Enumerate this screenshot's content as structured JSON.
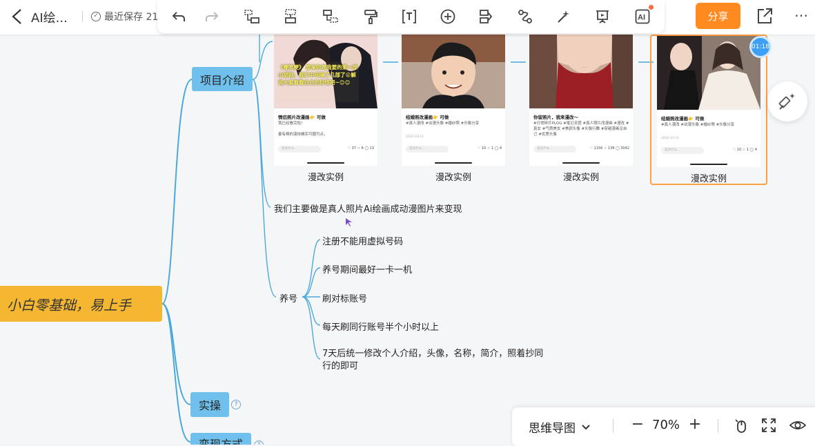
{
  "header": {
    "title": "AI绘...",
    "save_status": "最近保存 21",
    "share_label": "分享"
  },
  "toolbar": {
    "items": [
      "undo-icon",
      "redo-icon",
      "add-child-topic-icon",
      "add-sibling-topic-icon",
      "add-parent-topic-icon",
      "format-painter-icon",
      "text-icon",
      "insert-icon",
      "outline-icon",
      "relation-icon",
      "magic-icon",
      "present-icon",
      "ai-icon"
    ]
  },
  "timer": "01:18",
  "mindmap": {
    "root_text": "，小白零基础，易上手",
    "topics": {
      "intro": "项目介绍",
      "practice": "实操",
      "monetize": "变现方式"
    },
    "intro_text": "我们主要做是真人照片Ai绘画成动漫图片来变现",
    "raise_label": "养号",
    "raise_items": [
      "注册不能用虚拟号码",
      "养号期间最好一卡一机",
      "刷对标账号",
      "每天刷同行账号半个小时以上",
      "7天后统一修改个人介绍，头像，名称，简介，照着抄同行的即可"
    ],
    "cards": [
      {
        "label": "漫改实例",
        "title": "情侣照片改漫画👉 可做",
        "tags": "我已经看完啦！\n\n春有棉的演技确实可圈可点，",
        "date": "",
        "input": "说点什么...",
        "stats": "♡ 37  ☆ 6  ◯ 13",
        "overlay_text": "《嘲笑梗》 原来你是我要的第一部小甜剧，我们中间隔了几部了😜解说大家看看自己的珍惜吧~😊😊"
      },
      {
        "label": "漫改实例",
        "title": "结婚照改漫画👉 可做",
        "tags": "#真人漫改  #动漫头像  #婚纱照  #头像分享",
        "date": "2022-10-11",
        "input": "说点什么...",
        "stats": "♡ 10  ☆ 1  ◯ 4",
        "overlay_text": ""
      },
      {
        "label": "漫改实例",
        "title": "你留照片，我来漫改～",
        "tags": "#日常碎片PLOG  #笔记灵感  #真人照片改漫画  #漫改  #真女  #气质美女  #美颜头像  #头像行舞  #穿越漫画见自己  #优质头像",
        "date": "",
        "input": "说点什么...",
        "stats": "♡ 1156  ☆ 136  ◯ 3042",
        "overlay_text": ""
      },
      {
        "label": "漫改实例",
        "title": "结婚照改漫画👉 可做",
        "tags": "#真人漫改  #动漫头像  #婚纱照  #头像分享",
        "date": "2022-10-11",
        "input": "说点什么...",
        "stats": "♡ 10  ☆ 1  ◯ 4",
        "overlay_text": ""
      }
    ]
  },
  "bottom_bar": {
    "view_mode": "思维导图",
    "zoom": "70%"
  },
  "colors": {
    "accent": "#ff8a1f",
    "topic": "#6fc0ec",
    "root": "#f5b731",
    "line": "#4aa8dc",
    "selection": "#ff9f43"
  }
}
